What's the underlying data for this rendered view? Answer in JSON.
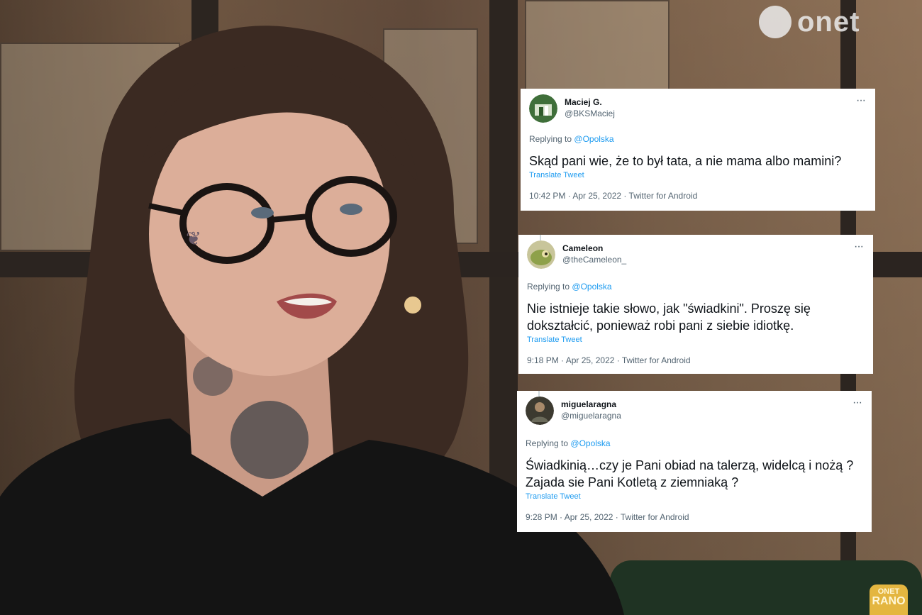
{
  "logos": {
    "onet": "onet",
    "rano_top": "ONET",
    "rano_bottom": "RANO"
  },
  "tweets": [
    {
      "display_name": "Maciej G.",
      "handle": "@BKSMaciej",
      "replying_label": "Replying to",
      "replying_to": "@Opolska",
      "text": "Skąd pani wie, że to był tata, a nie mama albo mamini?",
      "translate": "Translate Tweet",
      "meta": "10:42 PM · Apr 25, 2022 · Twitter for Android",
      "more": "···",
      "avatar_color": "#3f6f3a"
    },
    {
      "display_name": "Cameleon",
      "handle": "@theCameleon_",
      "replying_label": "Replying to",
      "replying_to": "@Opolska",
      "text": "Nie istnieje takie słowo, jak \"świadkini\". Proszę się dokształcić, ponieważ robi pani z siebie idiotkę.",
      "translate": "Translate Tweet",
      "meta": "9:18 PM · Apr 25, 2022 · Twitter for Android",
      "more": "···",
      "avatar_color": "#9aa65a"
    },
    {
      "display_name": "miguelaragna",
      "handle": "@miguelaragna",
      "replying_label": "Replying to",
      "replying_to": "@Opolska",
      "text": "Świadkinią…czy je Pani obiad na talerzą,  widelcą i nożą ? Zajada sie Pani Kotletą z ziemniaką ?",
      "translate": "Translate Tweet",
      "meta": "9:28 PM · Apr 25, 2022 · Twitter for Android",
      "more": "···",
      "avatar_color": "#4a4a3a"
    }
  ]
}
